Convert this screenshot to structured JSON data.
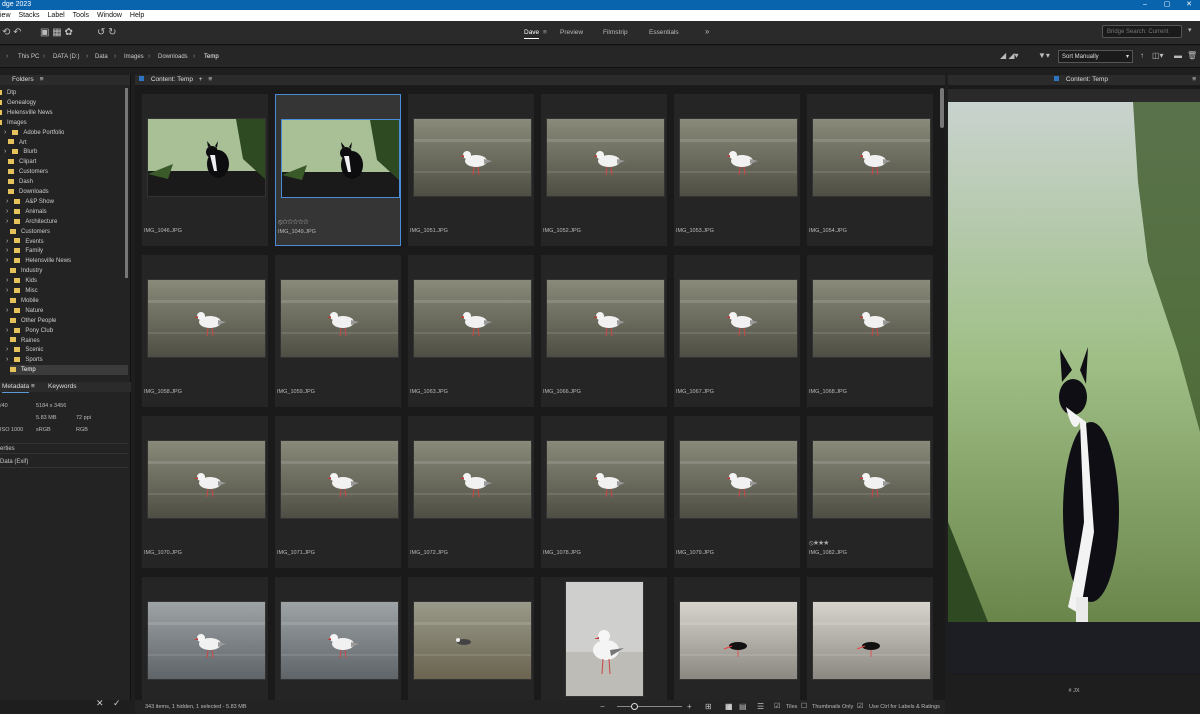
{
  "app": {
    "title": "dge 2023",
    "window_controls": [
      "–",
      "▢",
      "✕"
    ]
  },
  "menu": [
    "iew",
    "Stacks",
    "Label",
    "Tools",
    "Window",
    "Help"
  ],
  "workspaces": [
    {
      "label": "Dave",
      "active": true
    },
    {
      "label": "Preview",
      "active": false
    },
    {
      "label": "Filmstrip",
      "active": false
    },
    {
      "label": "Essentials",
      "active": false
    }
  ],
  "more_workspaces": "»",
  "search_placeholder": "Bridge Search: Current",
  "breadcrumb": [
    "This PC",
    "DATA (D:)",
    "Data",
    "Images",
    "Downloads",
    "Temp"
  ],
  "sort": {
    "label": "Sort Manually"
  },
  "folders_panel": {
    "tab": "Folders"
  },
  "folders": [
    {
      "label": "Dtp",
      "indent": 0,
      "chev": false
    },
    {
      "label": "Genealogy",
      "indent": 0,
      "chev": false
    },
    {
      "label": "Helensville News",
      "indent": 0,
      "chev": false
    },
    {
      "label": "Images",
      "indent": 0,
      "chev": false
    },
    {
      "label": "Adobe Portfolio",
      "indent": 1,
      "chev": true
    },
    {
      "label": "Art",
      "indent": 1,
      "chev": false
    },
    {
      "label": "Blurb",
      "indent": 1,
      "chev": true
    },
    {
      "label": "Clipart",
      "indent": 1,
      "chev": false
    },
    {
      "label": "Customers",
      "indent": 1,
      "chev": false
    },
    {
      "label": "Dash",
      "indent": 1,
      "chev": false
    },
    {
      "label": "Downloads",
      "indent": 1,
      "chev": false
    },
    {
      "label": "A&P Show",
      "indent": 2,
      "chev": true
    },
    {
      "label": "Animals",
      "indent": 2,
      "chev": true
    },
    {
      "label": "Architecture",
      "indent": 2,
      "chev": true
    },
    {
      "label": "Customers",
      "indent": 2,
      "chev": false
    },
    {
      "label": "Events",
      "indent": 2,
      "chev": true
    },
    {
      "label": "Family",
      "indent": 2,
      "chev": true
    },
    {
      "label": "Helensville News",
      "indent": 2,
      "chev": true
    },
    {
      "label": "Industry",
      "indent": 2,
      "chev": false
    },
    {
      "label": "Kids",
      "indent": 2,
      "chev": true
    },
    {
      "label": "Misc",
      "indent": 2,
      "chev": true
    },
    {
      "label": "Mobile",
      "indent": 2,
      "chev": false
    },
    {
      "label": "Nature",
      "indent": 2,
      "chev": true
    },
    {
      "label": "Other People",
      "indent": 2,
      "chev": false
    },
    {
      "label": "Pony Club",
      "indent": 2,
      "chev": true
    },
    {
      "label": "Raines",
      "indent": 2,
      "chev": false
    },
    {
      "label": "Scenic",
      "indent": 2,
      "chev": true
    },
    {
      "label": "Sports",
      "indent": 2,
      "chev": true
    },
    {
      "label": "Temp",
      "indent": 2,
      "chev": false,
      "selected": true
    }
  ],
  "metadata_panel": {
    "tabs": [
      "Metadata",
      "Keywords"
    ],
    "rows": [
      [
        "/40",
        "5184 x 3456",
        ""
      ],
      [
        "",
        "5.83 MB",
        "72 ppi"
      ],
      [
        "ISO 1000",
        "sRGB",
        "RGB"
      ]
    ],
    "sections": [
      "erties",
      "Data (Exif)"
    ]
  },
  "content_panel": {
    "tab": "Content: Temp"
  },
  "thumbnails": [
    {
      "name": "IMG_1046.JPG",
      "kind": "cat"
    },
    {
      "name": "IMG_1049.JPG",
      "kind": "cat",
      "selected": true,
      "stars": "⦸☆☆☆☆☆"
    },
    {
      "name": "IMG_1051.JPG",
      "kind": "gull"
    },
    {
      "name": "IMG_1052.JPG",
      "kind": "gull"
    },
    {
      "name": "IMG_1053.JPG",
      "kind": "gull"
    },
    {
      "name": "IMG_1054.JPG",
      "kind": "gull"
    },
    {
      "name": "IMG_1058.JPG",
      "kind": "gull"
    },
    {
      "name": "IMG_1059.JPG",
      "kind": "gull"
    },
    {
      "name": "IMG_1063.JPG",
      "kind": "gull"
    },
    {
      "name": "IMG_1066.JPG",
      "kind": "gull"
    },
    {
      "name": "IMG_1067.JPG",
      "kind": "gull"
    },
    {
      "name": "IMG_1068.JPG",
      "kind": "gull"
    },
    {
      "name": "IMG_1070.JPG",
      "kind": "gull"
    },
    {
      "name": "IMG_1071.JPG",
      "kind": "gull"
    },
    {
      "name": "IMG_1072.JPG",
      "kind": "gull"
    },
    {
      "name": "IMG_1078.JPG",
      "kind": "gull"
    },
    {
      "name": "IMG_1079.JPG",
      "kind": "gull"
    },
    {
      "name": "IMG_1082.JPG",
      "kind": "gull",
      "stars": "⦸★★★"
    },
    {
      "name": "",
      "kind": "grey"
    },
    {
      "name": "",
      "kind": "grey"
    },
    {
      "name": "",
      "kind": "sand"
    },
    {
      "name": "",
      "kind": "portrait"
    },
    {
      "name": "",
      "kind": "oyster"
    },
    {
      "name": "",
      "kind": "oyster"
    }
  ],
  "status": {
    "text": "343 items, 1 hidden, 1 selected - 5.83 MB",
    "tiles": "Tiles",
    "thumbs_only": "Thumbnails Only",
    "ctrl": "Use Ctrl for Labels & Ratings"
  },
  "preview_panel": {
    "tab": "Content: Temp",
    "caption": "# JX"
  },
  "colors": {
    "accent": "#0a64ad",
    "select": "#4a8cd8"
  }
}
